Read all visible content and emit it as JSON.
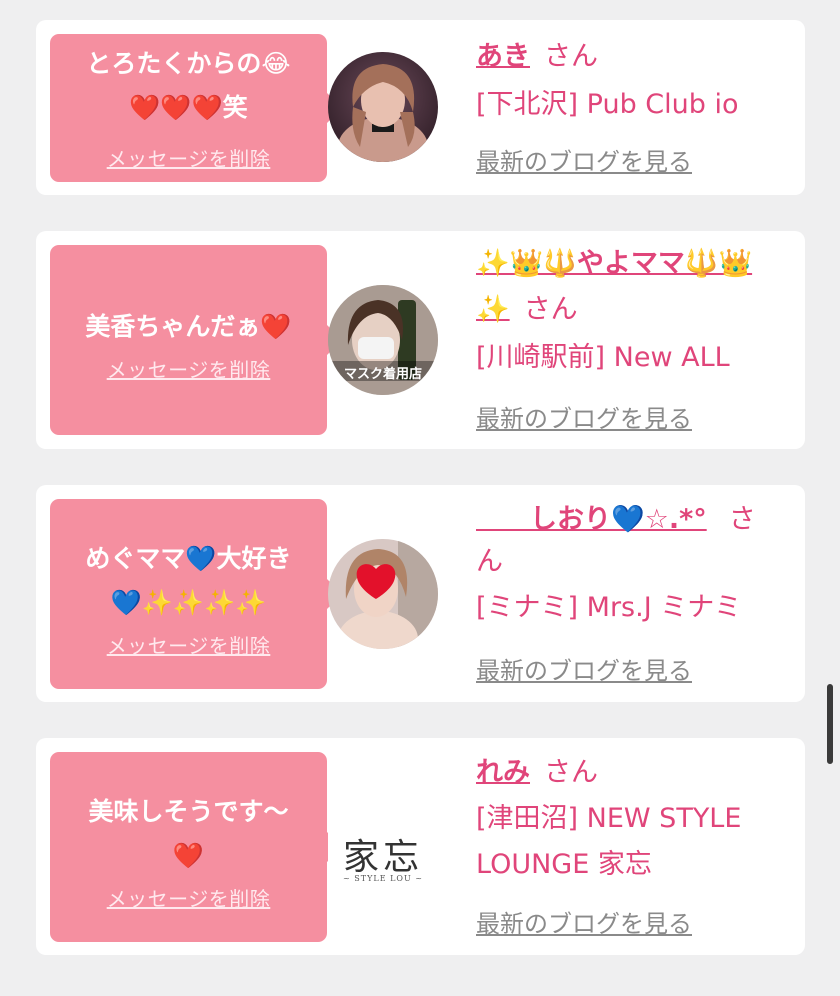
{
  "cards": [
    {
      "message_line1": "とろたくからの😂",
      "message_line2": "❤️❤️❤️笑",
      "delete_label": "メッセージを削除",
      "name": "あき",
      "name_line2": "",
      "honorific": "さん",
      "shop": "[下北沢] Pub Club io",
      "shop_line2": "",
      "blog_label": "最新のブログを見る"
    },
    {
      "message_line1": "美香ちゃんだぁ❤️",
      "message_line2": "",
      "delete_label": "メッセージを削除",
      "name": "✨👑🔱やよママ🔱👑",
      "name_line2": "✨",
      "honorific": "さん",
      "shop": "[川崎駅前] New ALL",
      "shop_line2": "",
      "avatar_caption": "マスク着用店",
      "blog_label": "最新のブログを見る"
    },
    {
      "message_line1": "めぐママ💙大好き",
      "message_line2": "💙✨✨✨✨",
      "delete_label": "メッセージを削除",
      "name": "　　しおり💙☆.*°",
      "name_line2": "ん",
      "honorific": "さ",
      "shop": "[ミナミ] Mrs.J ミナミ",
      "shop_line2": "",
      "blog_label": "最新のブログを見る"
    },
    {
      "message_line1": "美味しそうです〜",
      "message_line2": "❤️",
      "delete_label": "メッセージを削除",
      "name": "れみ",
      "name_line2": "",
      "honorific": "さん",
      "shop": "[津田沼] NEW STYLE",
      "shop_line2": "LOUNGE 家忘",
      "avatar_logo_main": "家忘",
      "avatar_logo_sub": "~ STYLE LOU ~",
      "blog_label": "最新のブログを見る"
    }
  ],
  "colors": {
    "page_bg": "#efeff0",
    "bubble": "#f58fa0",
    "link_pink": "#e0457a",
    "blog_gray": "#8a8a8a"
  }
}
